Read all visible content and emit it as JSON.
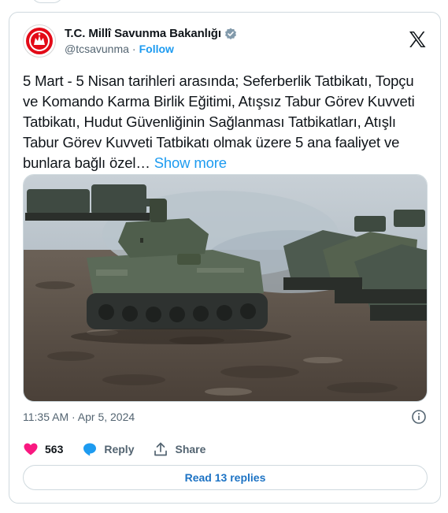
{
  "account": {
    "display_name": "T.C. Millî Savunma Bakanlığı",
    "handle": "@tcsavunma",
    "separator": "·",
    "follow_label": "Follow"
  },
  "tweet": {
    "text": "5 Mart - 5 Nisan tarihleri arasında; Seferberlik Tatbikatı, Topçu ve Komando Karma Birlik Eğitimi, Atışsız Tabur Görev Kuvveti Tatbikatı, Hudut Güvenliğinin Sağlanması Tatbikatları, Atışlı Tabur Görev Kuvveti Tatbikatı olmak üzere 5 ana faaliyet ve bunlara bağlı özel…",
    "show_more_label": "Show more",
    "timestamp": "11:35 AM · Apr 5, 2024"
  },
  "actions": {
    "like_count": "563",
    "reply_label": "Reply",
    "share_label": "Share"
  },
  "replies": {
    "label": "Read 13 replies"
  },
  "colors": {
    "accent": "#1d9bf0",
    "like": "#f91880",
    "muted": "#536471",
    "border": "#cfd9de"
  },
  "icons": [
    "msb-emblem-icon",
    "verified-badge-icon",
    "x-logo-icon",
    "info-icon",
    "heart-icon",
    "reply-icon",
    "share-icon"
  ]
}
